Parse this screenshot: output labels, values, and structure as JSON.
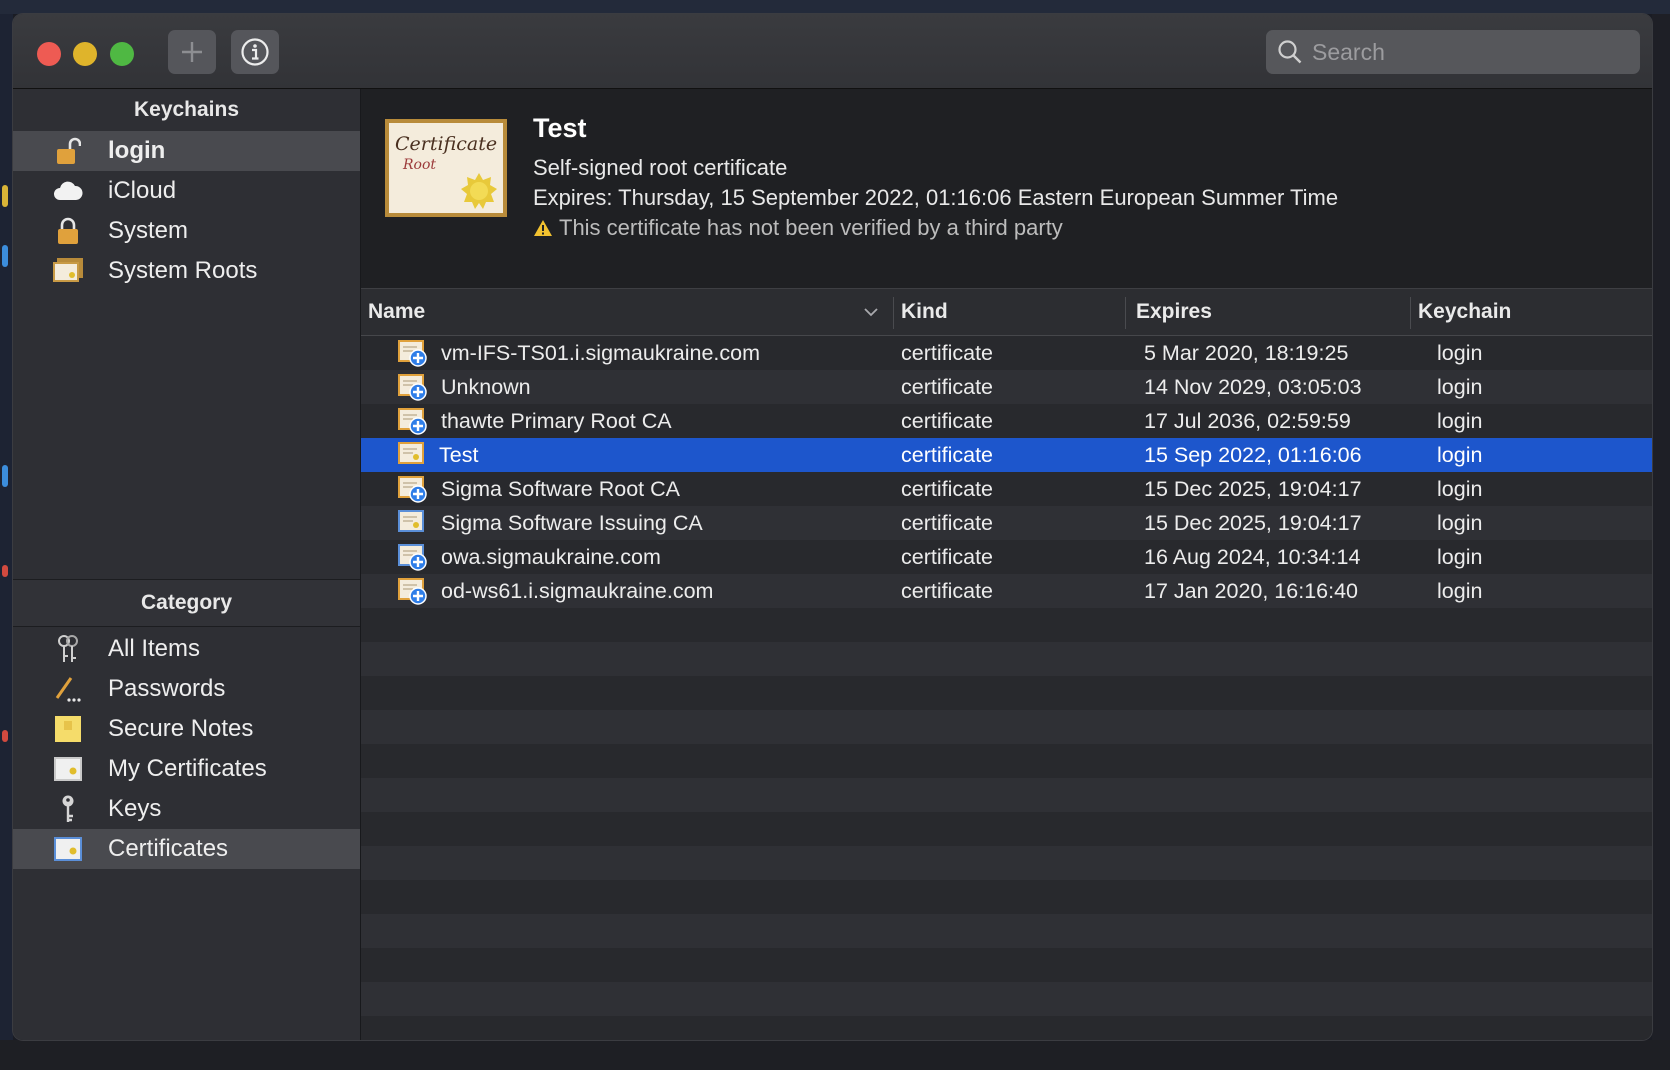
{
  "window": {
    "search_placeholder": "Search"
  },
  "sidebar": {
    "keychains_header": "Keychains",
    "keychains": [
      {
        "label": "login",
        "icon": "unlocked-padlock-icon",
        "selected": true
      },
      {
        "label": "iCloud",
        "icon": "cloud-icon",
        "selected": false
      },
      {
        "label": "System",
        "icon": "padlock-icon",
        "selected": false
      },
      {
        "label": "System Roots",
        "icon": "certificate-stack-icon",
        "selected": false
      }
    ],
    "category_header": "Category",
    "categories": [
      {
        "label": "All Items",
        "icon": "keys-icon",
        "selected": false
      },
      {
        "label": "Passwords",
        "icon": "pencil-dots-icon",
        "selected": false
      },
      {
        "label": "Secure Notes",
        "icon": "note-icon",
        "selected": false
      },
      {
        "label": "My Certificates",
        "icon": "certificate-person-icon",
        "selected": false
      },
      {
        "label": "Keys",
        "icon": "key-icon",
        "selected": false
      },
      {
        "label": "Certificates",
        "icon": "certificate-icon",
        "selected": true
      }
    ]
  },
  "detail": {
    "title": "Test",
    "subtitle": "Self-signed root certificate",
    "expires": "Expires: Thursday, 15 September 2022, 01:16:06 Eastern European Summer Time",
    "warning": "This certificate has not been verified by a third party",
    "badge_text_1": "Certificate",
    "badge_text_2": "Root"
  },
  "table": {
    "columns": [
      "Name",
      "Kind",
      "Expires",
      "Keychain"
    ],
    "rows": [
      {
        "name": "vm-IFS-TS01.i.sigmaukraine.com",
        "kind": "certificate",
        "expires": "5 Mar 2020, 18:19:25",
        "keychain": "login",
        "icon": "certificate-plus-icon"
      },
      {
        "name": "Unknown",
        "kind": "certificate",
        "expires": "14 Nov 2029, 03:05:03",
        "keychain": "login",
        "icon": "certificate-plus-icon"
      },
      {
        "name": "thawte Primary Root CA",
        "kind": "certificate",
        "expires": "17 Jul 2036, 02:59:59",
        "keychain": "login",
        "icon": "certificate-plus-icon"
      },
      {
        "name": "Test",
        "kind": "certificate",
        "expires": "15 Sep 2022, 01:16:06",
        "keychain": "login",
        "icon": "certificate-root-icon",
        "selected": true
      },
      {
        "name": "Sigma Software Root CA",
        "kind": "certificate",
        "expires": "15 Dec 2025, 19:04:17",
        "keychain": "login",
        "icon": "certificate-plus-icon"
      },
      {
        "name": "Sigma Software Issuing CA",
        "kind": "certificate",
        "expires": "15 Dec 2025, 19:04:17",
        "keychain": "login",
        "icon": "certificate-blue-icon"
      },
      {
        "name": "owa.sigmaukraine.com",
        "kind": "certificate",
        "expires": "16 Aug 2024, 10:34:14",
        "keychain": "login",
        "icon": "certificate-blue-plus-icon"
      },
      {
        "name": "od-ws61.i.sigmaukraine.com",
        "kind": "certificate",
        "expires": "17 Jan 2020, 16:16:40",
        "keychain": "login",
        "icon": "certificate-plus-icon"
      }
    ]
  },
  "colors": {
    "selection": "#1d56cc",
    "sidebar_selection": "#494a4f",
    "close": "#ee5b53",
    "minimize": "#dfb42b",
    "zoom": "#4fb843"
  }
}
